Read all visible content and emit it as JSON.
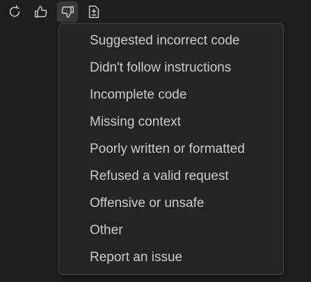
{
  "toolbar": {
    "buttons": [
      {
        "icon": "refresh-icon"
      },
      {
        "icon": "thumbs-up-icon"
      },
      {
        "icon": "thumbs-down-icon",
        "active": true
      },
      {
        "icon": "insert-diff-icon"
      }
    ],
    "icon_color": "#cccccc",
    "active_bg": "#3a3a3a"
  },
  "menu": {
    "items": [
      {
        "label": "Suggested incorrect code"
      },
      {
        "label": "Didn't follow instructions"
      },
      {
        "label": "Incomplete code"
      },
      {
        "label": "Missing context"
      },
      {
        "label": "Poorly written or formatted"
      },
      {
        "label": "Refused a valid request"
      },
      {
        "label": "Offensive or unsafe"
      },
      {
        "label": "Other"
      },
      {
        "label": "Report an issue"
      }
    ],
    "background": "#242424",
    "border": "#454545"
  }
}
